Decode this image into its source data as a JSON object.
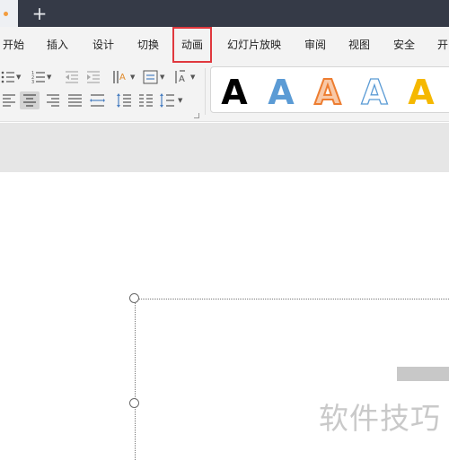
{
  "window": {
    "tab_dot_color": "#f39c3d",
    "new_tab_label": "+"
  },
  "menu": {
    "items": [
      {
        "label": "开始"
      },
      {
        "label": "插入"
      },
      {
        "label": "设计"
      },
      {
        "label": "切换"
      },
      {
        "label": "动画",
        "active": true
      },
      {
        "label": "幻灯片放映"
      },
      {
        "label": "审阅"
      },
      {
        "label": "视图"
      },
      {
        "label": "安全"
      },
      {
        "label": "开"
      }
    ]
  },
  "toolbar": {
    "row1": [
      "bullet-list-icon",
      "numbered-list-icon",
      "decrease-indent-icon",
      "increase-indent-icon",
      "text-direction-icon",
      "align-text-icon",
      "line-spacing-icon"
    ],
    "row2": [
      "align-left-icon",
      "align-center-icon",
      "align-right-icon",
      "justify-icon",
      "distribute-icon",
      "paragraph-spacing-icon",
      "columns-icon",
      "line-spacing-options-icon"
    ],
    "selected": "align-center-icon"
  },
  "text_styles": {
    "letter": "A",
    "colors": {
      "black": "#000000",
      "blue": "#5b9bd5",
      "orange": "#ed7d31",
      "outline": "#5b9bd5",
      "gold": "#f5b800"
    }
  },
  "watermark": "软件技巧"
}
